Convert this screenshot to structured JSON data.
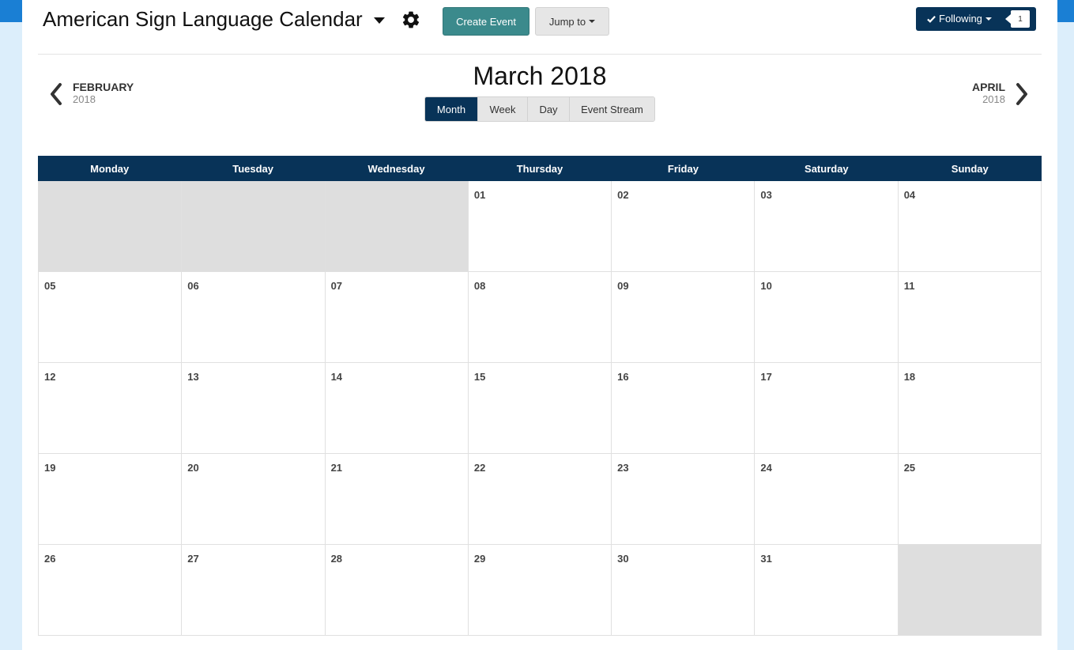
{
  "header": {
    "calendar_title": "American Sign Language Calendar",
    "create_event_label": "Create Event",
    "jump_to_label": "Jump to",
    "following_label": "Following",
    "following_count": "1"
  },
  "month_nav": {
    "title": "March 2018",
    "prev": {
      "month": "FEBRUARY",
      "year": "2018"
    },
    "next": {
      "month": "APRIL",
      "year": "2018"
    }
  },
  "view_tabs": [
    {
      "label": "Month",
      "active": true
    },
    {
      "label": "Week",
      "active": false
    },
    {
      "label": "Day",
      "active": false
    },
    {
      "label": "Event Stream",
      "active": false
    }
  ],
  "weekdays": [
    "Monday",
    "Tuesday",
    "Wednesday",
    "Thursday",
    "Friday",
    "Saturday",
    "Sunday"
  ],
  "weeks": [
    [
      "",
      "",
      "",
      "01",
      "02",
      "03",
      "04"
    ],
    [
      "05",
      "06",
      "07",
      "08",
      "09",
      "10",
      "11"
    ],
    [
      "12",
      "13",
      "14",
      "15",
      "16",
      "17",
      "18"
    ],
    [
      "19",
      "20",
      "21",
      "22",
      "23",
      "24",
      "25"
    ],
    [
      "26",
      "27",
      "28",
      "29",
      "30",
      "31",
      ""
    ]
  ],
  "colors": {
    "header_navy": "#083358",
    "create_teal": "#3b8a8c",
    "outside_day": "#dedede"
  }
}
